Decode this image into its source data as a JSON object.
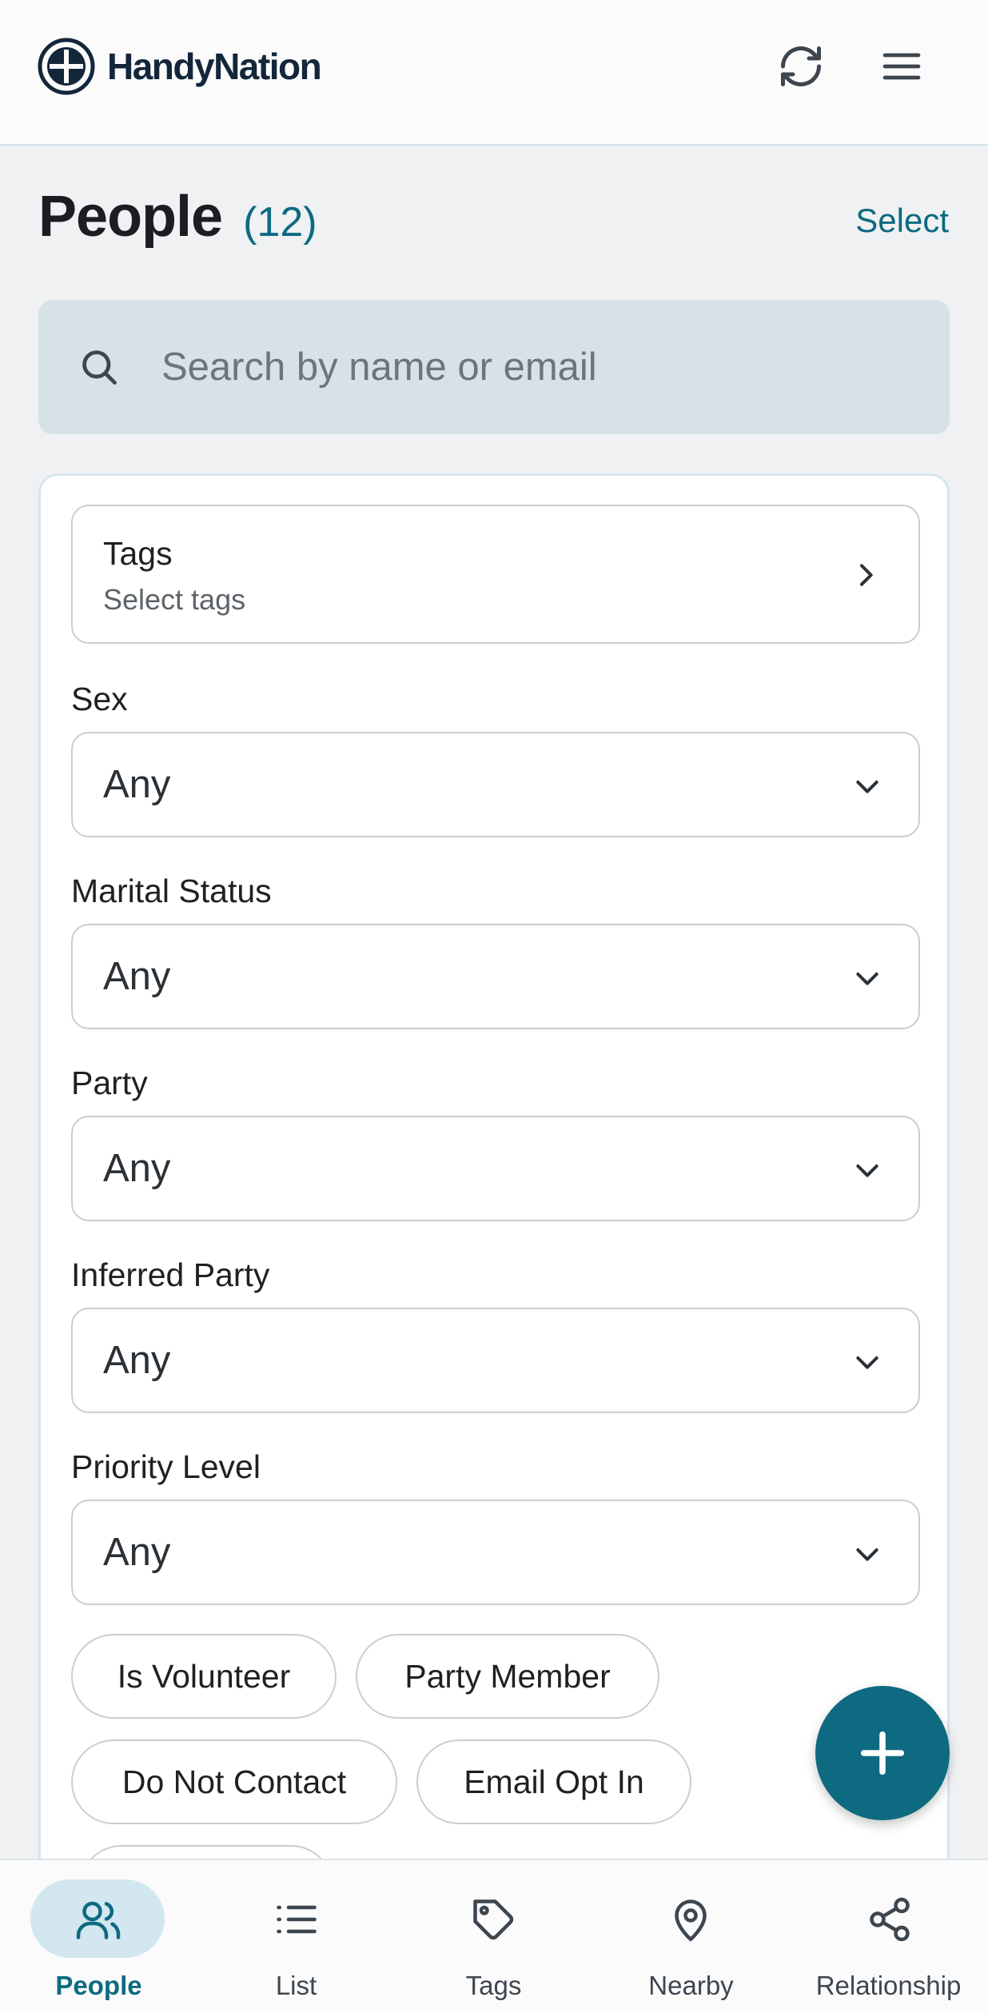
{
  "header": {
    "brand": "HandyNation",
    "icons": {
      "logo": "handynation-logo-icon",
      "refresh": "refresh-icon",
      "menu": "hamburger-menu-icon"
    }
  },
  "page": {
    "title": "People",
    "count": "(12)",
    "select_label": "Select"
  },
  "search": {
    "placeholder": "Search by name or email",
    "icon": "search-icon"
  },
  "filters": {
    "tags": {
      "title": "Tags",
      "subtitle": "Select tags"
    },
    "sex": {
      "label": "Sex",
      "value": "Any"
    },
    "marital_status": {
      "label": "Marital Status",
      "value": "Any"
    },
    "party": {
      "label": "Party",
      "value": "Any"
    },
    "inferred_party": {
      "label": "Inferred Party",
      "value": "Any"
    },
    "priority_level": {
      "label": "Priority Level",
      "value": "Any"
    },
    "chips": [
      "Is Volunteer",
      "Party Member",
      "Do Not Contact",
      "Email Opt In"
    ]
  },
  "fab": {
    "icon": "plus-icon"
  },
  "bottom_nav": {
    "items": [
      {
        "label": "People",
        "icon": "people-icon",
        "active": true
      },
      {
        "label": "List",
        "icon": "list-icon",
        "active": false
      },
      {
        "label": "Tags",
        "icon": "tag-icon",
        "active": false
      },
      {
        "label": "Nearby",
        "icon": "map-pin-icon",
        "active": false
      },
      {
        "label": "Relationship",
        "icon": "share-nodes-icon",
        "active": false
      }
    ]
  },
  "colors": {
    "accent": "#0d6a80",
    "background": "#eff1f3",
    "active_nav_pill": "#d2e7f0",
    "search_bg": "#d7e2e7"
  }
}
